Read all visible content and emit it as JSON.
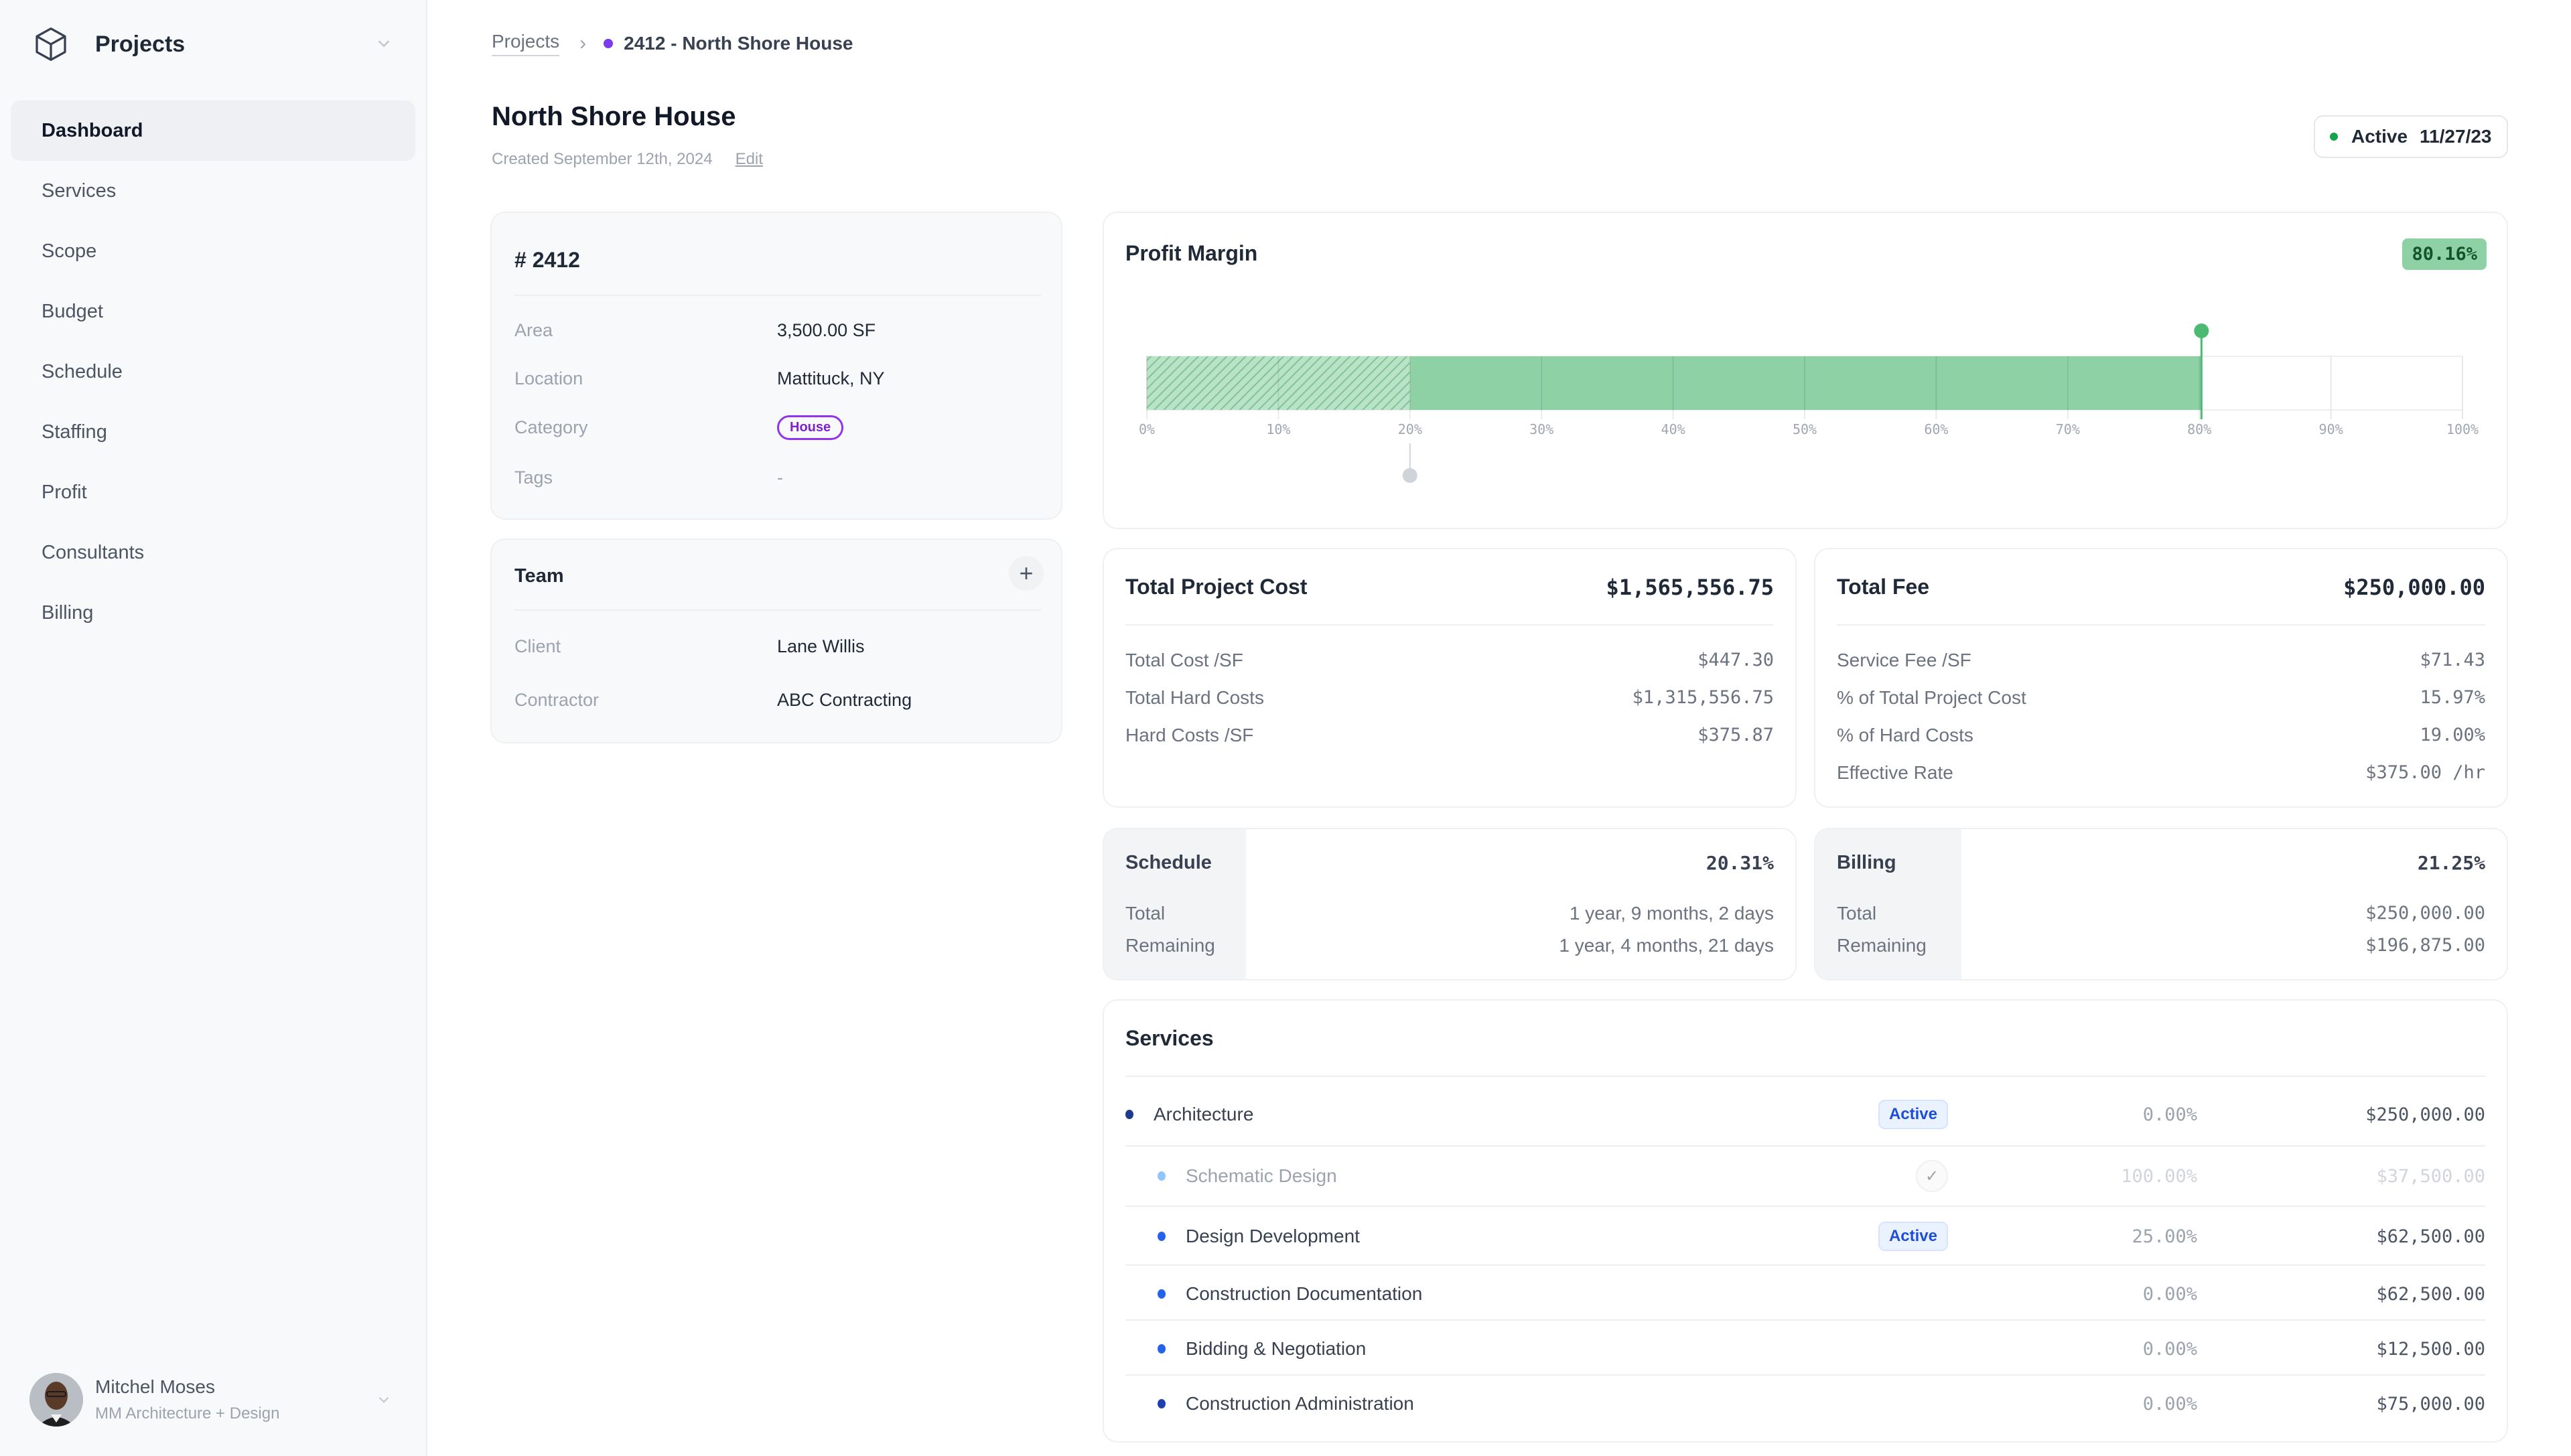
{
  "sidebar": {
    "app_title": "Projects",
    "logo_icon": "cube-icon",
    "items": [
      {
        "label": "Dashboard",
        "active": true
      },
      {
        "label": "Services"
      },
      {
        "label": "Scope"
      },
      {
        "label": "Budget"
      },
      {
        "label": "Schedule"
      },
      {
        "label": "Staffing"
      },
      {
        "label": "Profit"
      },
      {
        "label": "Consultants"
      },
      {
        "label": "Billing"
      }
    ],
    "user": {
      "name": "Mitchel Moses",
      "org": "MM Architecture + Design"
    }
  },
  "breadcrumb": {
    "root": "Projects",
    "current": "2412 - North Shore House",
    "dot_color": "#7c3aed"
  },
  "header": {
    "title": "North Shore House",
    "created": "Created September 12th, 2024",
    "edit_label": "Edit",
    "status": "Active",
    "status_date": "11/27/23",
    "status_color": "#16a34a"
  },
  "project_info": {
    "number_label": "# 2412",
    "rows": [
      {
        "label": "Area",
        "value": "3,500.00 SF"
      },
      {
        "label": "Location",
        "value": "Mattituck, NY"
      },
      {
        "label": "Category",
        "value": "House"
      },
      {
        "label": "Tags",
        "value": "-"
      }
    ]
  },
  "team": {
    "title": "Team",
    "add_icon": "plus-icon",
    "rows": [
      {
        "label": "Client",
        "value": "Lane Willis"
      },
      {
        "label": "Contractor",
        "value": "ABC Contracting"
      }
    ]
  },
  "profit_margin": {
    "title": "Profit Margin",
    "badge": "80.16%"
  },
  "chart_data": {
    "type": "bar",
    "title": "Profit Margin",
    "orientation": "horizontal",
    "value": 80.16,
    "target_marker": 20,
    "hatched_range": [
      0,
      20
    ],
    "xlim": [
      0,
      100
    ],
    "ticks": [
      0,
      10,
      20,
      30,
      40,
      50,
      60,
      70,
      80,
      90,
      100
    ],
    "tick_labels": [
      "0%",
      "10%",
      "20%",
      "30%",
      "40%",
      "50%",
      "60%",
      "70%",
      "80%",
      "90%",
      "100%"
    ],
    "bar_color": "#8dd1a4",
    "marker_color": "#4cba72",
    "target_color": "#cfd3da",
    "grid": true
  },
  "total_project_cost": {
    "title": "Total Project Cost",
    "value": "$1,565,556.75",
    "rows": [
      {
        "label": "Total Cost /SF",
        "value": "$447.30"
      },
      {
        "label": "Total Hard Costs",
        "value": "$1,315,556.75"
      },
      {
        "label": "Hard Costs /SF",
        "value": "$375.87"
      }
    ]
  },
  "total_fee": {
    "title": "Total Fee",
    "value": "$250,000.00",
    "rows": [
      {
        "label": "Service Fee /SF",
        "value": "$71.43"
      },
      {
        "label": "% of Total Project Cost",
        "value": "15.97%"
      },
      {
        "label": "% of Hard Costs",
        "value": "19.00%"
      },
      {
        "label": "Effective Rate",
        "value": "$375.00 /hr"
      }
    ]
  },
  "schedule": {
    "title": "Schedule",
    "percent": "20.31%",
    "rows": [
      {
        "label": "Total",
        "value": "1 year, 9 months, 2 days"
      },
      {
        "label": "Remaining",
        "value": "1 year, 4 months, 21 days"
      }
    ]
  },
  "billing": {
    "title": "Billing",
    "percent": "21.25%",
    "rows": [
      {
        "label": "Total",
        "value": "$250,000.00"
      },
      {
        "label": "Remaining",
        "value": "$196,875.00"
      }
    ]
  },
  "services": {
    "title": "Services",
    "rows": [
      {
        "name": "Architecture",
        "status": "Active",
        "percent": "0.00%",
        "amount": "$250,000.00"
      },
      {
        "name": "Schematic Design",
        "status": "complete",
        "percent": "100.00%",
        "amount": "$37,500.00"
      },
      {
        "name": "Design Development",
        "status": "Active",
        "percent": "25.00%",
        "amount": "$62,500.00"
      },
      {
        "name": "Construction Documentation",
        "status": "",
        "percent": "0.00%",
        "amount": "$62,500.00"
      },
      {
        "name": "Bidding & Negotiation",
        "status": "",
        "percent": "0.00%",
        "amount": "$12,500.00"
      },
      {
        "name": "Construction Administration",
        "status": "",
        "percent": "0.00%",
        "amount": "$75,000.00"
      }
    ]
  }
}
